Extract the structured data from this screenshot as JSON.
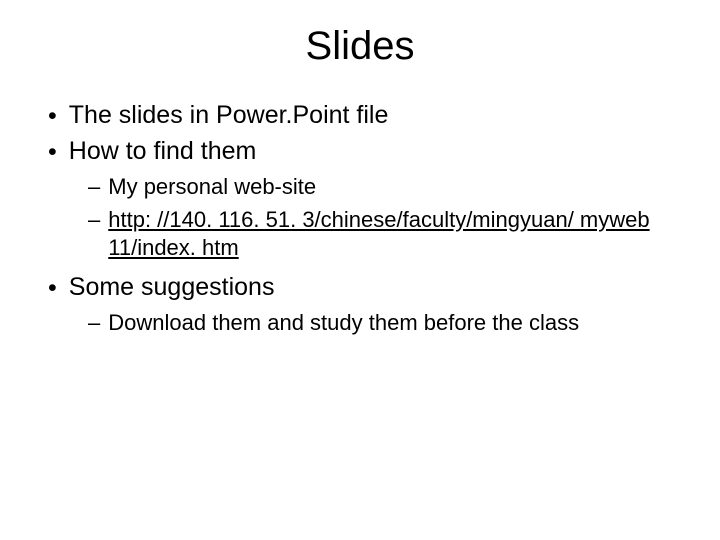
{
  "title": "Slides",
  "items": {
    "li1": "The slides in Power.Point file",
    "li2": "How to find them",
    "li2_1": "My personal web-site",
    "li2_2a": "http: //140. 116. 51. 3/chinese/faculty/mingyuan/ myweb 11/index. htm",
    "li3": "Some suggestions",
    "li3_1": "Download them and study them before the class"
  },
  "bullet": "•",
  "dash": "–"
}
